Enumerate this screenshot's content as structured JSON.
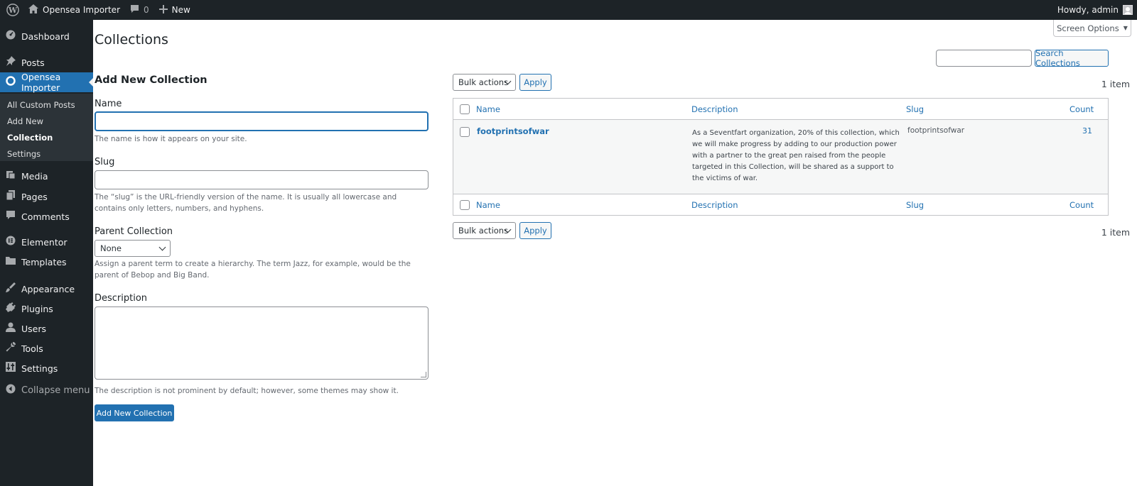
{
  "adminbar": {
    "site_name": "Opensea Importer",
    "comments_count": "0",
    "new_label": "New",
    "howdy": "Howdy, admin"
  },
  "sidebar": {
    "items": [
      {
        "label": "Dashboard",
        "icon": "dashboard-icon"
      },
      {
        "label": "Posts",
        "icon": "pin-icon"
      },
      {
        "label": "Opensea Importer",
        "icon": "circle-icon"
      },
      {
        "label": "Media",
        "icon": "media-icon"
      },
      {
        "label": "Pages",
        "icon": "pages-icon"
      },
      {
        "label": "Comments",
        "icon": "comment-icon"
      },
      {
        "label": "Elementor",
        "icon": "elementor-icon"
      },
      {
        "label": "Templates",
        "icon": "folder-icon"
      },
      {
        "label": "Appearance",
        "icon": "brush-icon"
      },
      {
        "label": "Plugins",
        "icon": "plug-icon"
      },
      {
        "label": "Users",
        "icon": "user-icon"
      },
      {
        "label": "Tools",
        "icon": "wrench-icon"
      },
      {
        "label": "Settings",
        "icon": "settings-icon"
      }
    ],
    "submenu": [
      "All Custom Posts",
      "Add New",
      "Collection",
      "Settings"
    ],
    "collapse": "Collapse menu"
  },
  "header": {
    "screen_options": "Screen Options",
    "title": "Collections",
    "search_button": "Search Collections",
    "search_value": ""
  },
  "form": {
    "title": "Add New Collection",
    "name_label": "Name",
    "name_value": "",
    "name_help": "The name is how it appears on your site.",
    "slug_label": "Slug",
    "slug_value": "",
    "slug_help": "The “slug” is the URL-friendly version of the name. It is usually all lowercase and contains only letters, numbers, and hyphens.",
    "parent_label": "Parent Collection",
    "parent_selected": "None",
    "parent_help": "Assign a parent term to create a hierarchy. The term Jazz, for example, would be the parent of Bebop and Big Band.",
    "desc_label": "Description",
    "desc_value": "",
    "desc_help": "The description is not prominent by default; however, some themes may show it.",
    "submit": "Add New Collection"
  },
  "list": {
    "bulk_label": "Bulk actions",
    "apply_label": "Apply",
    "items_count": "1 item",
    "columns": {
      "name": "Name",
      "description": "Description",
      "slug": "Slug",
      "count": "Count"
    },
    "rows": [
      {
        "name": "footprintsofwar",
        "description": "As a Seventfart organization, 20% of this collection, which we will make progress by adding to our production power with a partner to the great pen raised from the people targeted in this Collection, will be shared as a support to the victims of war.",
        "slug": "footprintsofwar",
        "count": "31"
      }
    ]
  },
  "colors": {
    "admin_dark": "#1d2327",
    "accent_blue": "#2271b1",
    "content_bg": "#ffffff"
  }
}
